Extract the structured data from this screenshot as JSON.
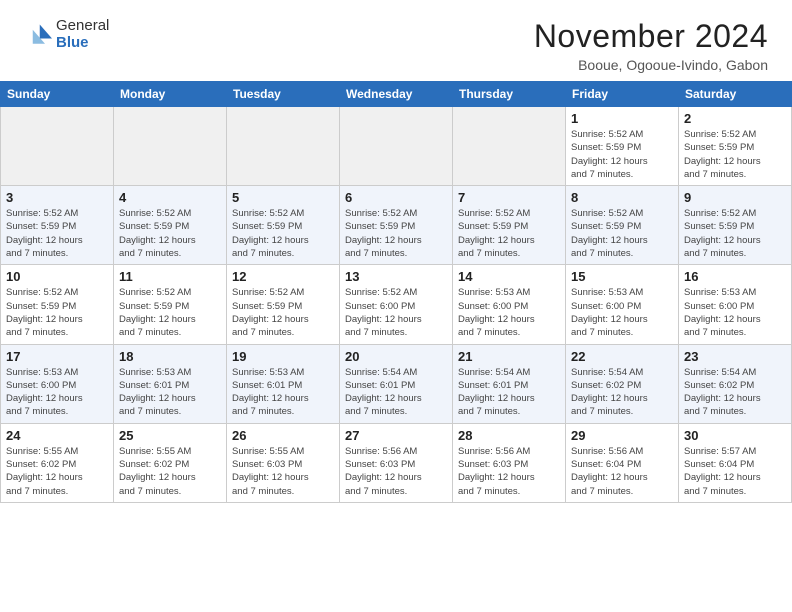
{
  "header": {
    "logo_general": "General",
    "logo_blue": "Blue",
    "month_title": "November 2024",
    "location": "Booue, Ogooue-Ivindo, Gabon"
  },
  "weekdays": [
    "Sunday",
    "Monday",
    "Tuesday",
    "Wednesday",
    "Thursday",
    "Friday",
    "Saturday"
  ],
  "weeks": [
    {
      "shade": "light",
      "days": [
        {
          "num": "",
          "info": "",
          "empty": true
        },
        {
          "num": "",
          "info": "",
          "empty": true
        },
        {
          "num": "",
          "info": "",
          "empty": true
        },
        {
          "num": "",
          "info": "",
          "empty": true
        },
        {
          "num": "",
          "info": "",
          "empty": true
        },
        {
          "num": "1",
          "info": "Sunrise: 5:52 AM\nSunset: 5:59 PM\nDaylight: 12 hours\nand 7 minutes.",
          "empty": false
        },
        {
          "num": "2",
          "info": "Sunrise: 5:52 AM\nSunset: 5:59 PM\nDaylight: 12 hours\nand 7 minutes.",
          "empty": false
        }
      ]
    },
    {
      "shade": "dark",
      "days": [
        {
          "num": "3",
          "info": "Sunrise: 5:52 AM\nSunset: 5:59 PM\nDaylight: 12 hours\nand 7 minutes.",
          "empty": false
        },
        {
          "num": "4",
          "info": "Sunrise: 5:52 AM\nSunset: 5:59 PM\nDaylight: 12 hours\nand 7 minutes.",
          "empty": false
        },
        {
          "num": "5",
          "info": "Sunrise: 5:52 AM\nSunset: 5:59 PM\nDaylight: 12 hours\nand 7 minutes.",
          "empty": false
        },
        {
          "num": "6",
          "info": "Sunrise: 5:52 AM\nSunset: 5:59 PM\nDaylight: 12 hours\nand 7 minutes.",
          "empty": false
        },
        {
          "num": "7",
          "info": "Sunrise: 5:52 AM\nSunset: 5:59 PM\nDaylight: 12 hours\nand 7 minutes.",
          "empty": false
        },
        {
          "num": "8",
          "info": "Sunrise: 5:52 AM\nSunset: 5:59 PM\nDaylight: 12 hours\nand 7 minutes.",
          "empty": false
        },
        {
          "num": "9",
          "info": "Sunrise: 5:52 AM\nSunset: 5:59 PM\nDaylight: 12 hours\nand 7 minutes.",
          "empty": false
        }
      ]
    },
    {
      "shade": "light",
      "days": [
        {
          "num": "10",
          "info": "Sunrise: 5:52 AM\nSunset: 5:59 PM\nDaylight: 12 hours\nand 7 minutes.",
          "empty": false
        },
        {
          "num": "11",
          "info": "Sunrise: 5:52 AM\nSunset: 5:59 PM\nDaylight: 12 hours\nand 7 minutes.",
          "empty": false
        },
        {
          "num": "12",
          "info": "Sunrise: 5:52 AM\nSunset: 5:59 PM\nDaylight: 12 hours\nand 7 minutes.",
          "empty": false
        },
        {
          "num": "13",
          "info": "Sunrise: 5:52 AM\nSunset: 6:00 PM\nDaylight: 12 hours\nand 7 minutes.",
          "empty": false
        },
        {
          "num": "14",
          "info": "Sunrise: 5:53 AM\nSunset: 6:00 PM\nDaylight: 12 hours\nand 7 minutes.",
          "empty": false
        },
        {
          "num": "15",
          "info": "Sunrise: 5:53 AM\nSunset: 6:00 PM\nDaylight: 12 hours\nand 7 minutes.",
          "empty": false
        },
        {
          "num": "16",
          "info": "Sunrise: 5:53 AM\nSunset: 6:00 PM\nDaylight: 12 hours\nand 7 minutes.",
          "empty": false
        }
      ]
    },
    {
      "shade": "dark",
      "days": [
        {
          "num": "17",
          "info": "Sunrise: 5:53 AM\nSunset: 6:00 PM\nDaylight: 12 hours\nand 7 minutes.",
          "empty": false
        },
        {
          "num": "18",
          "info": "Sunrise: 5:53 AM\nSunset: 6:01 PM\nDaylight: 12 hours\nand 7 minutes.",
          "empty": false
        },
        {
          "num": "19",
          "info": "Sunrise: 5:53 AM\nSunset: 6:01 PM\nDaylight: 12 hours\nand 7 minutes.",
          "empty": false
        },
        {
          "num": "20",
          "info": "Sunrise: 5:54 AM\nSunset: 6:01 PM\nDaylight: 12 hours\nand 7 minutes.",
          "empty": false
        },
        {
          "num": "21",
          "info": "Sunrise: 5:54 AM\nSunset: 6:01 PM\nDaylight: 12 hours\nand 7 minutes.",
          "empty": false
        },
        {
          "num": "22",
          "info": "Sunrise: 5:54 AM\nSunset: 6:02 PM\nDaylight: 12 hours\nand 7 minutes.",
          "empty": false
        },
        {
          "num": "23",
          "info": "Sunrise: 5:54 AM\nSunset: 6:02 PM\nDaylight: 12 hours\nand 7 minutes.",
          "empty": false
        }
      ]
    },
    {
      "shade": "light",
      "days": [
        {
          "num": "24",
          "info": "Sunrise: 5:55 AM\nSunset: 6:02 PM\nDaylight: 12 hours\nand 7 minutes.",
          "empty": false
        },
        {
          "num": "25",
          "info": "Sunrise: 5:55 AM\nSunset: 6:02 PM\nDaylight: 12 hours\nand 7 minutes.",
          "empty": false
        },
        {
          "num": "26",
          "info": "Sunrise: 5:55 AM\nSunset: 6:03 PM\nDaylight: 12 hours\nand 7 minutes.",
          "empty": false
        },
        {
          "num": "27",
          "info": "Sunrise: 5:56 AM\nSunset: 6:03 PM\nDaylight: 12 hours\nand 7 minutes.",
          "empty": false
        },
        {
          "num": "28",
          "info": "Sunrise: 5:56 AM\nSunset: 6:03 PM\nDaylight: 12 hours\nand 7 minutes.",
          "empty": false
        },
        {
          "num": "29",
          "info": "Sunrise: 5:56 AM\nSunset: 6:04 PM\nDaylight: 12 hours\nand 7 minutes.",
          "empty": false
        },
        {
          "num": "30",
          "info": "Sunrise: 5:57 AM\nSunset: 6:04 PM\nDaylight: 12 hours\nand 7 minutes.",
          "empty": false
        }
      ]
    }
  ]
}
